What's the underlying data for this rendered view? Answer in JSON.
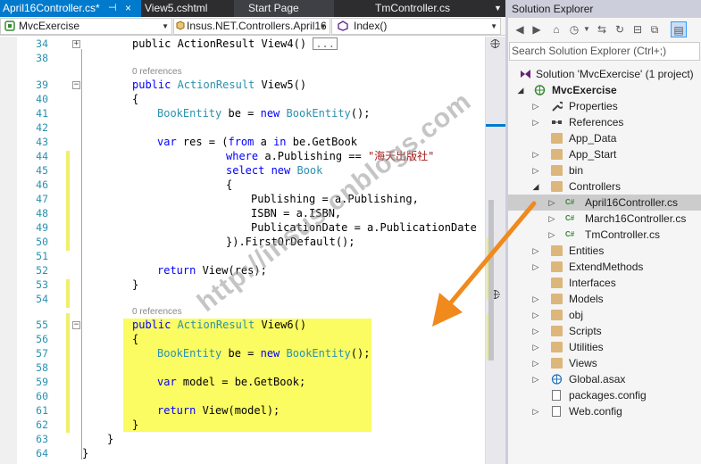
{
  "tabs": [
    {
      "label": "April16Controller.cs*",
      "active": true
    },
    {
      "label": "View5.cshtml"
    },
    {
      "label": "Start Page"
    },
    {
      "label": "TmController.cs"
    }
  ],
  "tab_pin_glyph": "⊣",
  "tab_close_glyph": "×",
  "navbar": {
    "project": "MvcExercise",
    "class": "Insus.NET.Controllers.April16",
    "member": "Index()"
  },
  "editor": {
    "line_numbers": [
      "34",
      "38",
      "39",
      "40",
      "41",
      "42",
      "43",
      "44",
      "45",
      "46",
      "47",
      "48",
      "49",
      "50",
      "51",
      "52",
      "53",
      "54",
      "55",
      "56",
      "57",
      "58",
      "59",
      "60",
      "61",
      "62",
      "63",
      "64"
    ],
    "references_label": "0 references",
    "view4": "public ActionResult View4()",
    "collapsed": "...",
    "view5": "public ActionResult View5()",
    "open_brace": "{",
    "close_brace": "}",
    "line41": "BookEntity be = new BookEntity();",
    "line43": "var res = (from a in be.GetBook",
    "line44_a": "where a.Publishing == ",
    "line44_str": "\"海天出版社\"",
    "line45": "select new Book",
    "line47": "Publishing = a.Publishing,",
    "line48": "ISBN = a.ISBN,",
    "line49": "PublicationDate = a.PublicationDate",
    "line50": "}).FirstOrDefault();",
    "line52": "return View(res);",
    "view6": "public ActionResult View6()",
    "line57": "BookEntity be = new BookEntity();",
    "line59": "var model = be.GetBook;",
    "line61": "return View(model);"
  },
  "watermark": "http://insus.cnblogs.com",
  "solution_explorer": {
    "title": "Solution Explorer",
    "search_placeholder": "Search Solution Explorer (Ctrl+;)",
    "solution": "Solution 'MvcExercise' (1 project)",
    "project": "MvcExercise",
    "items": [
      {
        "label": "Properties",
        "icon": "wrench-icon"
      },
      {
        "label": "References",
        "icon": "references-icon"
      },
      {
        "label": "App_Data",
        "icon": "folder-icon"
      },
      {
        "label": "App_Start",
        "icon": "folder-icon"
      },
      {
        "label": "bin",
        "icon": "folder-icon"
      },
      {
        "label": "Controllers",
        "icon": "folder-icon"
      },
      {
        "label": "April16Controller.cs",
        "icon": "csharp-file-icon"
      },
      {
        "label": "March16Controller.cs",
        "icon": "csharp-file-icon"
      },
      {
        "label": "TmController.cs",
        "icon": "csharp-file-icon"
      },
      {
        "label": "Entities",
        "icon": "folder-icon"
      },
      {
        "label": "ExtendMethods",
        "icon": "folder-icon"
      },
      {
        "label": "Interfaces",
        "icon": "folder-icon"
      },
      {
        "label": "Models",
        "icon": "folder-icon"
      },
      {
        "label": "obj",
        "icon": "folder-icon"
      },
      {
        "label": "Scripts",
        "icon": "folder-icon"
      },
      {
        "label": "Utilities",
        "icon": "folder-icon"
      },
      {
        "label": "Views",
        "icon": "folder-icon"
      },
      {
        "label": "Global.asax",
        "icon": "web-file-icon"
      },
      {
        "label": "packages.config",
        "icon": "config-file-icon"
      },
      {
        "label": "Web.config",
        "icon": "config-file-icon"
      }
    ],
    "csharp_badge": "C#"
  },
  "colors": {
    "accent": "#007acc",
    "highlight": "#fbfb62",
    "arrow": "#f08a1d",
    "keyword": "#0000ff",
    "type": "#2b91af",
    "string": "#a31515"
  }
}
